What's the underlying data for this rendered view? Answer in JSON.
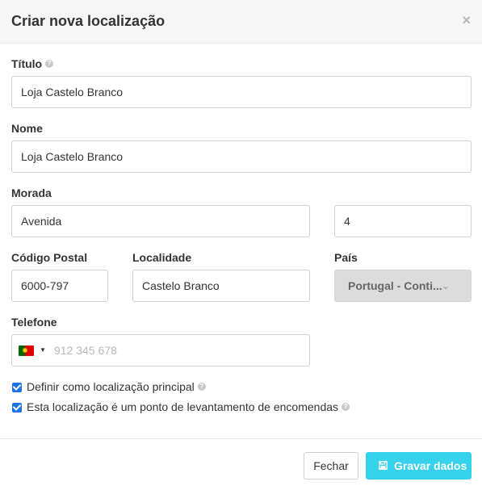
{
  "header": {
    "title": "Criar nova localização",
    "close_symbol": "×"
  },
  "form": {
    "titulo": {
      "label": "Título",
      "value": "Loja Castelo Branco"
    },
    "nome": {
      "label": "Nome",
      "value": "Loja Castelo Branco"
    },
    "morada": {
      "label": "Morada",
      "street": "Avenida",
      "number": "4"
    },
    "codigo_postal": {
      "label": "Código Postal",
      "value": "6000-797"
    },
    "localidade": {
      "label": "Localidade",
      "value": "Castelo Branco"
    },
    "pais": {
      "label": "País",
      "value": "Portugal - Conti..."
    },
    "telefone": {
      "label": "Telefone",
      "placeholder": "912 345 678",
      "country_flag": "portugal-flag-icon"
    },
    "options": [
      {
        "label": "Definir como localização principal",
        "checked": true
      },
      {
        "label": "Esta localização é um ponto de levantamento de encomendas",
        "checked": true
      }
    ],
    "help_symbol": "?"
  },
  "footer": {
    "close_label": "Fechar",
    "save_label": "Gravar dados"
  },
  "colors": {
    "accent": "#36d1ec",
    "checkbox": "#1a73e8",
    "header_bg": "#f6f6f6"
  }
}
